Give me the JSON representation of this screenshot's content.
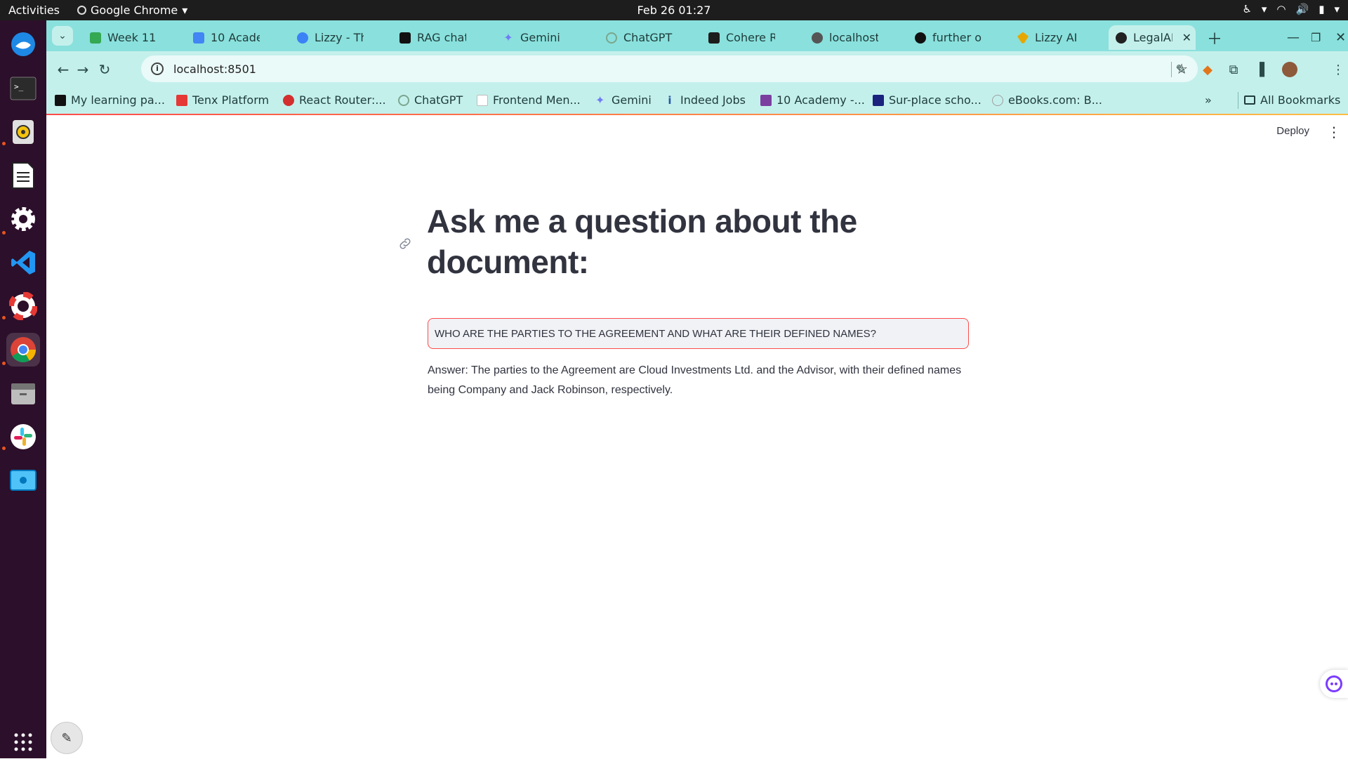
{
  "topbar": {
    "activities": "Activities",
    "app_name": "Google Chrome",
    "clock": "Feb 26  01:27"
  },
  "dock": {
    "items": [
      "thunderbird-icon",
      "terminal-icon",
      "rhythmbox-icon",
      "text-editor-icon",
      "settings-icon",
      "vscode-icon",
      "help-icon",
      "chrome-icon",
      "files-icon",
      "slack-icon",
      "screenshot-icon"
    ],
    "apps_grid": "show-apps-icon"
  },
  "tabs": [
    {
      "label": "Week 11",
      "color": "#34a853"
    },
    {
      "label": "10 Acade",
      "color": "#4285f4"
    },
    {
      "label": "Lizzy - Th",
      "color": "#3b82f6"
    },
    {
      "label": "RAG chat",
      "color": "#111111"
    },
    {
      "label": "Gemini",
      "color": "#6f7cf6"
    },
    {
      "label": "ChatGPT",
      "color": "#7aa68f"
    },
    {
      "label": "Cohere R",
      "color": "#1d1d1d"
    },
    {
      "label": "localhost",
      "color": "#555555"
    },
    {
      "label": "further o",
      "color": "#111111"
    },
    {
      "label": "Lizzy AI",
      "color": "#e6a700"
    },
    {
      "label": "LegalAI-R",
      "color": "#222222",
      "active": true
    }
  ],
  "toolbar": {
    "url": "localhost:8501"
  },
  "bookmarks": [
    {
      "label": "My learning pa...",
      "color": "#111111"
    },
    {
      "label": "Tenx Platform",
      "color": "#e53935"
    },
    {
      "label": "React Router:...",
      "color": "#d32f2f"
    },
    {
      "label": "ChatGPT",
      "color": "#7aa68f"
    },
    {
      "label": "Frontend Men...",
      "color": "#bdbdbd"
    },
    {
      "label": "Gemini",
      "color": "#6f7cf6"
    },
    {
      "label": "Indeed Jobs",
      "color": "#2557a7"
    },
    {
      "label": "10 Academy -...",
      "color": "#7b3fa0"
    },
    {
      "label": "Sur-place scho...",
      "color": "#1a237e"
    },
    {
      "label": "eBooks.com: B...",
      "color": "#9e9e9e"
    }
  ],
  "all_bookmarks": "All Bookmarks",
  "app": {
    "deploy": "Deploy",
    "title": "Ask me a question about the document:",
    "question_value": "WHO ARE THE PARTIES TO THE AGREEMENT AND WHAT ARE THEIR DEFINED NAMES?",
    "answer": "Answer: The parties to the Agreement are Cloud Investments Ltd. and the Advisor, with their defined names being Company and Jack Robinson, respectively."
  }
}
